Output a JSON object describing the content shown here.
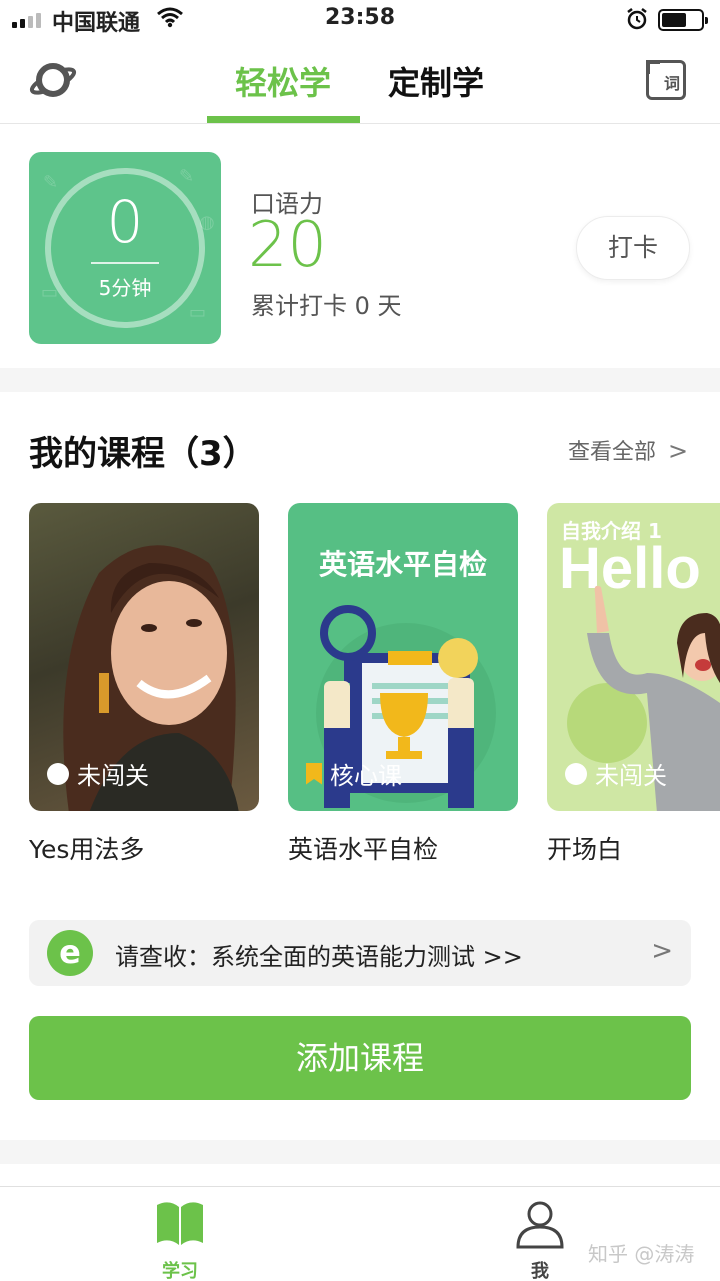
{
  "status_bar": {
    "carrier": "中国联通",
    "time": "23:58"
  },
  "header": {
    "tab_easy": "轻松学",
    "tab_custom": "定制学",
    "dict_label": "词"
  },
  "stats": {
    "minutes_value": "0",
    "minutes_label": "5分钟",
    "skill_label": "口语力",
    "skill_score": "20",
    "streak_text": "累计打卡 0 天",
    "checkin_label": "打卡"
  },
  "courses": {
    "title": "我的课程（3）",
    "view_all": "查看全部",
    "items": [
      {
        "name": "Yes用法多",
        "badge": "未闯关",
        "badge_type": "dot"
      },
      {
        "name": "英语水平自检",
        "cover_title": "英语水平自检",
        "badge": "核心课",
        "badge_type": "flag"
      },
      {
        "name": "开场白",
        "cover_title": "自我介绍 1",
        "cover_big": "Hello",
        "badge": "未闯关",
        "badge_type": "dot"
      }
    ]
  },
  "promo": {
    "icon": "e",
    "text": "请查收：系统全面的英语能力测试 >>"
  },
  "add_course": "添加课程",
  "tab_bar": {
    "learn": "学习",
    "me": "我"
  },
  "watermark": "知乎 @涛涛",
  "colors": {
    "accent": "#6cc24a",
    "tile": "#5ec48b"
  },
  "icons": [
    "planet-icon",
    "dictionary-icon",
    "chevron-right-icon",
    "book-icon",
    "person-icon",
    "wifi-icon",
    "alarm-icon",
    "battery-icon"
  ]
}
